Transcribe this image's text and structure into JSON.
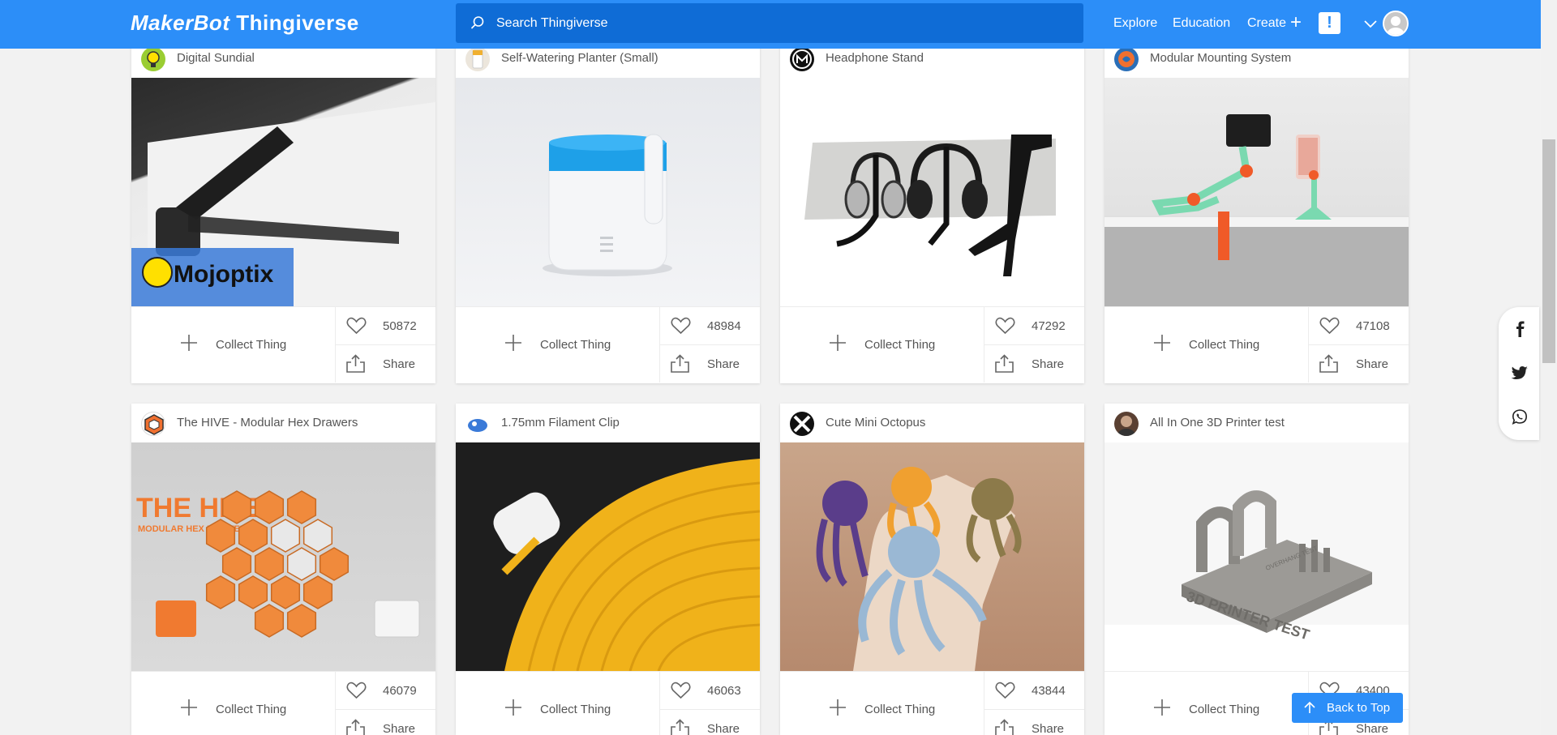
{
  "header": {
    "logo_brand": "MakerBot",
    "logo_name": "Thingiverse",
    "search_placeholder": "Search Thingiverse",
    "nav_explore": "Explore",
    "nav_education": "Education",
    "nav_create": "Create",
    "create_plus": "+",
    "alert": "!"
  },
  "cards": [
    {
      "title": "Digital Sundial",
      "likes": "50872",
      "collect": "Collect Thing",
      "share": "Share",
      "overlay": "Mojoptix"
    },
    {
      "title": "Self-Watering Planter (Small)",
      "likes": "48984",
      "collect": "Collect Thing",
      "share": "Share"
    },
    {
      "title": "Headphone Stand",
      "likes": "47292",
      "collect": "Collect Thing",
      "share": "Share"
    },
    {
      "title": "Modular Mounting System",
      "likes": "47108",
      "collect": "Collect Thing",
      "share": "Share"
    },
    {
      "title": "The HIVE - Modular Hex Drawers",
      "likes": "46079",
      "collect": "Collect Thing",
      "share": "Share",
      "overlay": "THE HIVE",
      "overlay_sub": "MODULAR HEX DRAWERS"
    },
    {
      "title": "1.75mm Filament Clip",
      "likes": "46063",
      "collect": "Collect Thing",
      "share": "Share"
    },
    {
      "title": "Cute Mini Octopus",
      "likes": "43844",
      "collect": "Collect Thing",
      "share": "Share"
    },
    {
      "title": "All In One 3D Printer test",
      "likes": "43400",
      "collect": "Collect Thing",
      "share": "Share",
      "overlay": "3D PRINTER TEST",
      "overlay_sub": "OVERHANG TEST"
    }
  ],
  "back_to_top": "Back to Top",
  "colors": {
    "brand": "#2c8ef8",
    "search_bg": "#0f6cd6"
  }
}
